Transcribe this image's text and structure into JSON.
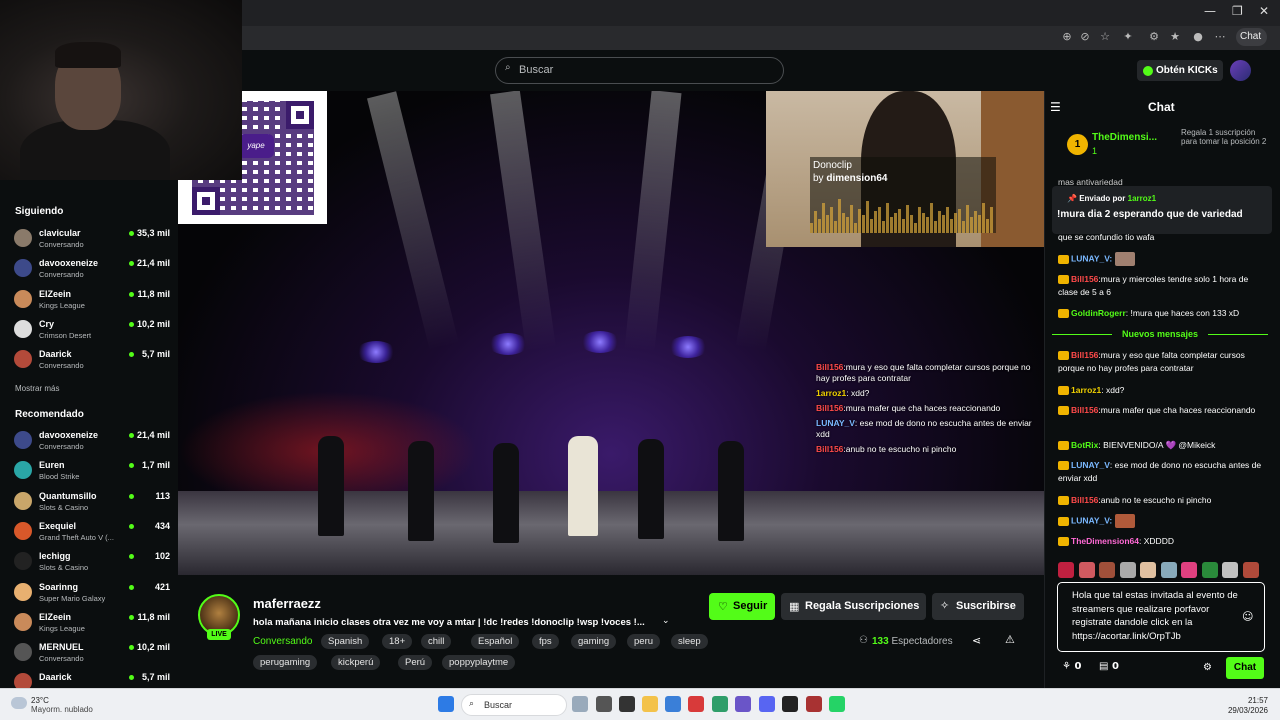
{
  "header": {
    "search_placeholder": "Buscar",
    "kicks_button": "Obtén KICKs",
    "browser_chat_label": "Chat"
  },
  "sidebar": {
    "following_heading": "Siguiendo",
    "show_more": "Mostrar más",
    "recommended_heading": "Recomendado",
    "following": [
      {
        "name": "clavicular",
        "sub": "Conversando",
        "count": "35,3 mil",
        "color": "#8a7a6a"
      },
      {
        "name": "davooxeneize",
        "sub": "Conversando",
        "count": "21,4 mil",
        "color": "#3d4a8a"
      },
      {
        "name": "ElZeein",
        "sub": "Kings League",
        "count": "11,8 mil",
        "color": "#c98a5a"
      },
      {
        "name": "Cry",
        "sub": "Crimson Desert",
        "count": "10,2 mil",
        "color": "#ddd"
      },
      {
        "name": "Daarick",
        "sub": "Conversando",
        "count": "5,7 mil",
        "color": "#b34a3a"
      }
    ],
    "recommended": [
      {
        "name": "davooxeneize",
        "sub": "Conversando",
        "count": "21,4 mil",
        "color": "#3d4a8a"
      },
      {
        "name": "Euren",
        "sub": "Blood Strike",
        "count": "1,7 mil",
        "color": "#2aa6a6"
      },
      {
        "name": "Quantumsillo",
        "sub": "Slots & Casino",
        "count": "113",
        "color": "#c9a66a"
      },
      {
        "name": "Exequiel",
        "sub": "Grand Theft Auto V (...",
        "count": "434",
        "color": "#d8582a"
      },
      {
        "name": "lechigg",
        "sub": "Slots & Casino",
        "count": "102",
        "color": "#222"
      },
      {
        "name": "Soarinng",
        "sub": "Super Mario Galaxy",
        "count": "421",
        "color": "#e8b070"
      },
      {
        "name": "ElZeein",
        "sub": "Kings League",
        "count": "11,8 mil",
        "color": "#c98a5a"
      },
      {
        "name": "MERNUEL",
        "sub": "Conversando",
        "count": "10,2 mil",
        "color": "#555"
      },
      {
        "name": "Daarick",
        "sub": "",
        "count": "5,7 mil",
        "color": "#b34a3a"
      }
    ]
  },
  "video": {
    "donoclip_title": "Donoclip",
    "donoclip_by": "by",
    "donoclip_user": "dimension64",
    "qr_logo": "yape",
    "overlay_messages": [
      {
        "user": "Bill156",
        "text": ":mura y eso que falta completar cursos porque no hay profes para contratar",
        "color": "#ff4a4a"
      },
      {
        "user": "1arroz1",
        "text": ": xdd?",
        "color": "#f0d000"
      },
      {
        "user": "Bill156",
        "text": ":mura mafer que cha haces reaccionando",
        "color": "#ff4a4a"
      },
      {
        "user": "LUNAY_V",
        "text": ": ese mod de dono no escucha antes de enviar xdd",
        "color": "#7ab8ff"
      },
      {
        "user": "Bill156",
        "text": ":anub no te escucho ni pincho",
        "color": "#ff4a4a"
      }
    ]
  },
  "stream": {
    "channel": "maferraezz",
    "live": "LIVE",
    "title": "hola mañana inicio clases otra vez me voy a mtar | !dc !redes !donoclip !wsp !voces !...",
    "category": "Conversando",
    "tags_row1": [
      "Spanish",
      "18+",
      "chill",
      "Español",
      "fps",
      "gaming",
      "peru",
      "sleep"
    ],
    "tags_row2": [
      "perugaming",
      "kickperú",
      "Perú",
      "poppyplaytme"
    ],
    "follow": "Seguir",
    "gift_subs": "Regala Suscripciones",
    "subscribe": "Suscribirse",
    "viewers_count": "133",
    "viewers_label": "Espectadores"
  },
  "chat": {
    "title": "Chat",
    "leader_rank": "1",
    "leader_name": "TheDimensi...",
    "leader_count": "1",
    "leader_promo": "Regala 1 suscripción para tomar la posición 2",
    "partial_top": "mas antivariedad",
    "pinned_label": "Enviado por",
    "pinned_user": "1arroz1",
    "pinned_text": "!mura dia 2 esperando que de variedad",
    "new_messages": "Nuevos mensajes",
    "messages_before": [
      {
        "user": "",
        "text": "que se confundio tio wafa",
        "ucolor": "#fff"
      },
      {
        "user": "LUNAY_V:",
        "text": "",
        "ucolor": "#7ab8ff",
        "emote": "#a08070"
      },
      {
        "user": "Bill156",
        "text": ":mura y miercoles tendre solo 1 hora de clase de 5 a 6",
        "ucolor": "#ff4a4a"
      },
      {
        "user": "GoldinRogerr",
        "text": ": !mura que haces con 133 xD",
        "ucolor": "#53fc18"
      }
    ],
    "messages_after": [
      {
        "user": "Bill156",
        "text": ":mura y eso que falta completar cursos porque no hay profes para contratar",
        "ucolor": "#ff4a4a"
      },
      {
        "user": "1arroz1",
        "text": ": xdd?",
        "ucolor": "#f0d000"
      },
      {
        "user": "Bill156",
        "text": ":mura mafer que cha haces reaccionando",
        "ucolor": "#ff4a4a"
      },
      {
        "user": "BotRix",
        "text": ": BIENVENIDO/A 💜 @Mikeick",
        "ucolor": "#53fc18"
      },
      {
        "user": "LUNAY_V",
        "text": ": ese mod de dono no escucha antes de enviar xdd",
        "ucolor": "#7ab8ff"
      },
      {
        "user": "Bill156",
        "text": ":anub no te escucho ni pincho",
        "ucolor": "#ff4a4a"
      },
      {
        "user": "LUNAY_V:",
        "text": "",
        "ucolor": "#7ab8ff",
        "emote": "#b05a3a"
      },
      {
        "user": "TheDimension64",
        "text": ": XDDDD",
        "ucolor": "#ff6ad5"
      }
    ],
    "input_text": "Hola que tal estas invitada al evento de streamers que realizare porfavor registrate dandole click en la https://acortar.link/OrpTJb",
    "kicks_count": "0",
    "gifts_count": "0",
    "send_label": "Chat"
  },
  "taskbar": {
    "temp": "23°C",
    "weather": "Mayorm. nublado",
    "search": "Buscar",
    "time": "21:57",
    "date": "29/03/2026"
  },
  "colors": {
    "accent": "#53fc18",
    "background": "#0b0e0f"
  }
}
